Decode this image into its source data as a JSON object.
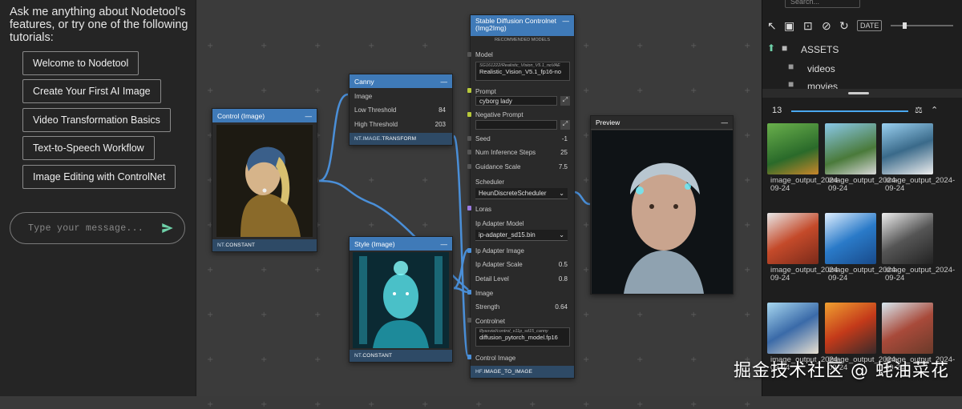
{
  "chat": {
    "intro": "Ask me anything about Nodetool's features, or try one of the following tutorials:",
    "tutorials": [
      "Welcome to Nodetool",
      "Create Your First AI Image",
      "Video Transformation Basics",
      "Text-to-Speech Workflow",
      "Image Editing with ControlNet"
    ],
    "input_placeholder": "Type your message..."
  },
  "nodes": {
    "control": {
      "title": "Control (Image)",
      "footer_ns": "NT.",
      "footer_name": "CONSTANT",
      "menu": "—"
    },
    "canny": {
      "title": "Canny",
      "image_label": "Image",
      "low_label": "Low Threshold",
      "low_value": "84",
      "high_label": "High Threshold",
      "high_value": "203",
      "footer_ns": "NT.IMAGE.",
      "footer_name": "TRANSFORM",
      "menu": "—"
    },
    "style": {
      "title": "Style (Image)",
      "footer_ns": "NT.",
      "footer_name": "CONSTANT",
      "menu": "—"
    },
    "sd": {
      "title": "Stable Diffusion Controlnet (Img2Img)",
      "subtitle": "RECOMMENDED MODELS",
      "model_label": "Model",
      "model_path": "SG161222/Realistic_Vision_V5.1_noVAE",
      "model_value": "Realistic_Vision_V5.1_fp16-no",
      "prompt_label": "Prompt",
      "prompt_value": "cyborg lady",
      "neg_label": "Negative Prompt",
      "neg_value": "",
      "seed_label": "Seed",
      "seed_value": "-1",
      "steps_label": "Num Inference Steps",
      "steps_value": "25",
      "guidance_label": "Guidance Scale",
      "guidance_value": "7.5",
      "scheduler_label": "Scheduler",
      "scheduler_value": "HeunDiscreteScheduler",
      "loras_label": "Loras",
      "ipmodel_label": "Ip Adapter Model",
      "ipmodel_value": "ip-adapter_sd15.bin",
      "ipimage_label": "Ip Adapter Image",
      "ipscale_label": "Ip Adapter Scale",
      "ipscale_value": "0.5",
      "detail_label": "Detail Level",
      "detail_value": "0.8",
      "image_label": "Image",
      "strength_label": "Strength",
      "strength_value": "0.64",
      "controlnet_label": "Controlnet",
      "controlnet_path": "lllyasviel/control_v11p_sd15_canny",
      "controlnet_value": "diffusion_pytorch_model.fp16",
      "controlimage_label": "Control Image",
      "footer_ns": "HF.",
      "footer_name": "IMAGE_TO_IMAGE",
      "menu": "—",
      "expand_icon": "⤢"
    },
    "preview": {
      "title": "Preview",
      "menu": "—"
    }
  },
  "assets": {
    "search_placeholder": "Search...",
    "date_label": "DATE",
    "root": "ASSETS",
    "folders": [
      "videos",
      "movies"
    ],
    "count": "13",
    "captions": [
      "image_output_2024-09-24",
      "image_output_2024-09-24",
      "image_output_2024-09-24",
      "image_output_2024-09-24",
      "image_output_2024-09-24",
      "image_output_2024-09-24",
      "image_output_2024-09-24",
      "image_output_2024-09-24",
      "image_output_2024-09-24"
    ]
  },
  "watermark": "掘金技术社区 @ 蚝油菜花"
}
